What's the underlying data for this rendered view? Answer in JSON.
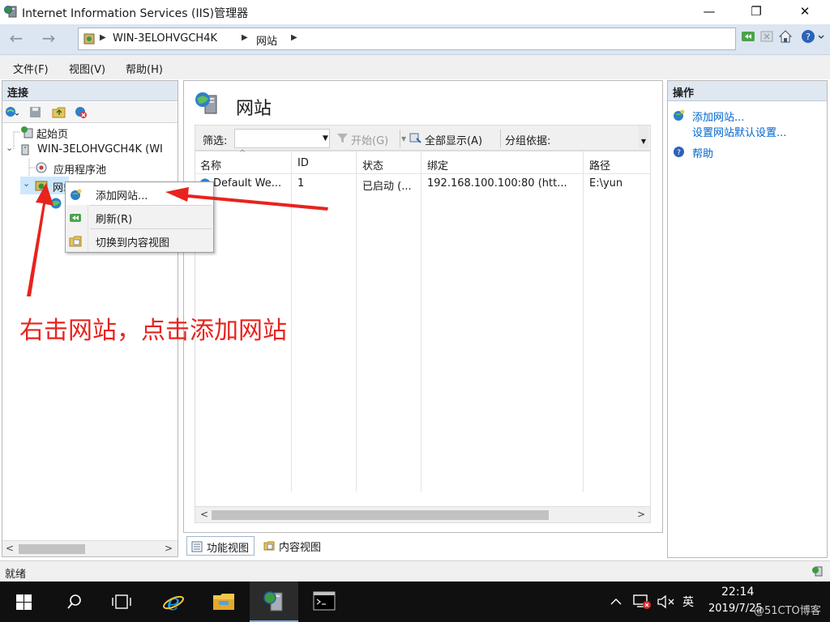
{
  "window": {
    "title": "Internet Information Services (IIS)管理器",
    "minimize": "—",
    "maximize": "❐",
    "close": "✕"
  },
  "address": {
    "segments": [
      "WIN-3ELOHVGCH4K",
      "网站"
    ],
    "arrow": "▶",
    "back": "←",
    "forward": "→"
  },
  "menu": [
    "文件(F)",
    "视图(V)",
    "帮助(H)"
  ],
  "connections": {
    "header": "连接",
    "tree": {
      "start_page": "起始页",
      "server": "WIN-3ELOHVGCH4K (WI",
      "app_pools": "应用程序池",
      "sites": "网站",
      "expand_open": "⌄"
    },
    "scroll_left": "<",
    "scroll_right": ">"
  },
  "center": {
    "title": "网站",
    "filter_label": "筛选:",
    "start_label": "开始(G)",
    "show_all_label": "全部显示(A)",
    "group_label": "分组依据:",
    "columns": [
      "名称",
      "ID",
      "状态",
      "绑定",
      "路径"
    ],
    "rows": [
      {
        "name": "Default We...",
        "id": "1",
        "status": "已启动 (...",
        "binding": "192.168.100.100:80 (htt...",
        "path": "E:\\yun"
      }
    ],
    "scroll_left": "<",
    "scroll_right": ">",
    "view_tabs": [
      "功能视图",
      "内容视图"
    ]
  },
  "actions": {
    "header": "操作",
    "items": [
      "添加网站...",
      "设置网站默认设置...",
      "帮助"
    ]
  },
  "context_menu": {
    "items": [
      "添加网站...",
      "刷新(R)",
      "切换到内容视图"
    ]
  },
  "status": {
    "text": "就绪"
  },
  "taskbar": {
    "ime": "英",
    "time": "22:14",
    "date": "2019/7/25",
    "watermark": "@51CTO博客"
  },
  "annotation": {
    "text": "右击网站，点击添加网站",
    "color": "#e8231e"
  },
  "colors": {
    "accent_link": "#0066cc",
    "panel_header": "#dfe7f1",
    "taskbar": "#101010"
  }
}
